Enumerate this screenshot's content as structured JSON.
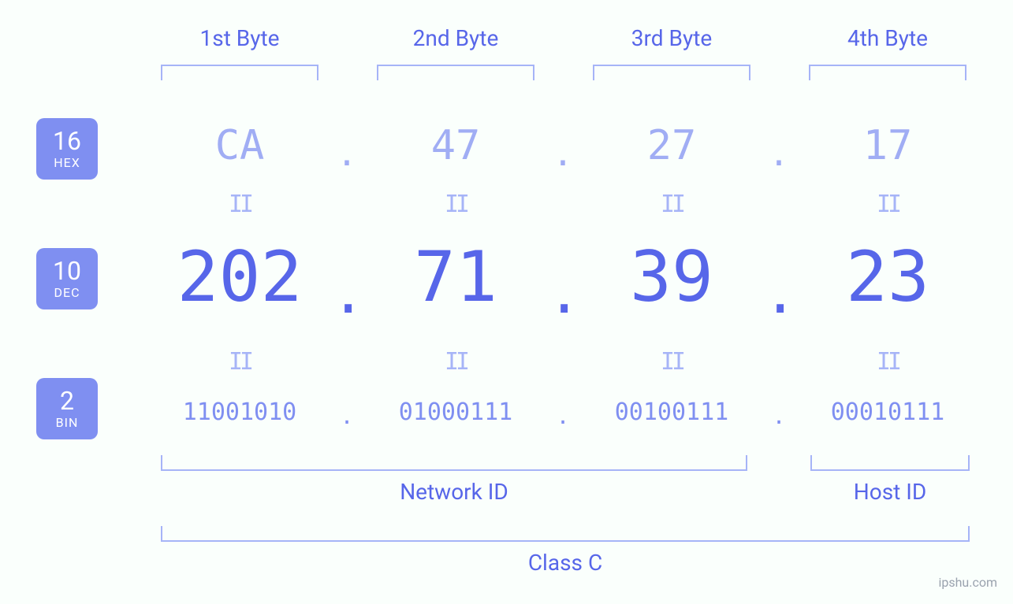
{
  "bytes": {
    "headers": [
      "1st Byte",
      "2nd Byte",
      "3rd Byte",
      "4th Byte"
    ]
  },
  "badges": {
    "hex": {
      "num": "16",
      "txt": "HEX"
    },
    "dec": {
      "num": "10",
      "txt": "DEC"
    },
    "bin": {
      "num": "2",
      "txt": "BIN"
    }
  },
  "hex": [
    "CA",
    "47",
    "27",
    "17"
  ],
  "dec": [
    "202",
    "71",
    "39",
    "23"
  ],
  "bin": [
    "11001010",
    "01000111",
    "00100111",
    "00010111"
  ],
  "dot": ".",
  "eq": "II",
  "labels": {
    "network": "Network ID",
    "host": "Host ID",
    "class": "Class C"
  },
  "watermark": "ipshu.com"
}
